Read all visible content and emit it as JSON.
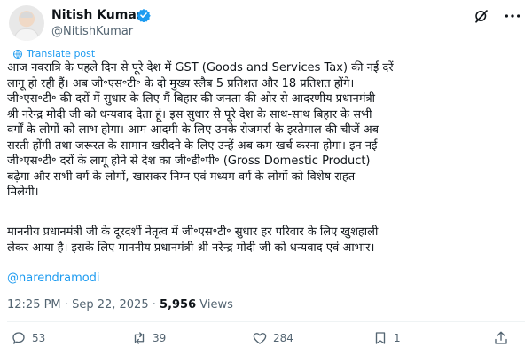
{
  "header": {
    "name": "Nitish Kumar",
    "handle": "@NitishKumar",
    "icons": [
      "avatar",
      "verified-badge-icon",
      "grok-icon",
      "more-icon"
    ]
  },
  "translate_label": "Translate post",
  "body": {
    "paragraph1": "आज नवरात्रि के पहले दिन से पूरे देश में GST (Goods and Services Tax) की नई दरें\nलागू हो रही हैं। अब जी॰एस॰टी॰ के दो मुख्य स्लैब 5 प्रतिशत और 18 प्रतिशत होंगे।\nजी॰एस॰टी॰ की दरों में सुधार के लिए मैं बिहार की जनता की ओर से आदरणीय प्रधानमंत्री\nश्री नरेन्द्र मोदी जी को धन्यवाद देता हूं। इस सुधार से पूरे देश के साथ-साथ बिहार के सभी\nवर्गों के लोगों को लाभ होगा। आम आदमी के लिए उनके रोजमर्रा के इस्तेमाल की चीजें अब\nसस्ती होंगी तथा जरूरत के सामान खरीदने के लिए उन्हें अब कम खर्च करना होगा। इन नई\nजी॰एस॰टी॰ दरों के लागू होने से देश का जी॰डी॰पी॰ (Gross Domestic Product)\nबढ़ेगा और सभी वर्ग के लोगों, खासकर निम्न एवं मध्यम वर्ग के लोगों को विशेष राहत\nमिलेगी।",
    "paragraph2": "माननीय प्रधानमंत्री जी के दूरदर्शी नेतृत्व में जी॰एस॰टी॰ सुधार हर परिवार के लिए खुशहाली\nलेकर आया है। इसके लिए माननीय प्रधानमंत्री श्री नरेन्द्र मोदी जी को धन्यवाद एवं आभार।",
    "mention": "@narendramodi"
  },
  "meta": {
    "time": "12:25 PM",
    "separator": "·",
    "date": "Sep 22, 2025",
    "views_count": "5,956",
    "views_label": "Views"
  },
  "actions": {
    "replies": "53",
    "reposts": "39",
    "likes": "284",
    "bookmarks": "1"
  },
  "colors": {
    "accent": "#1d9bf0",
    "text": "#0f1419",
    "muted": "#536471"
  }
}
